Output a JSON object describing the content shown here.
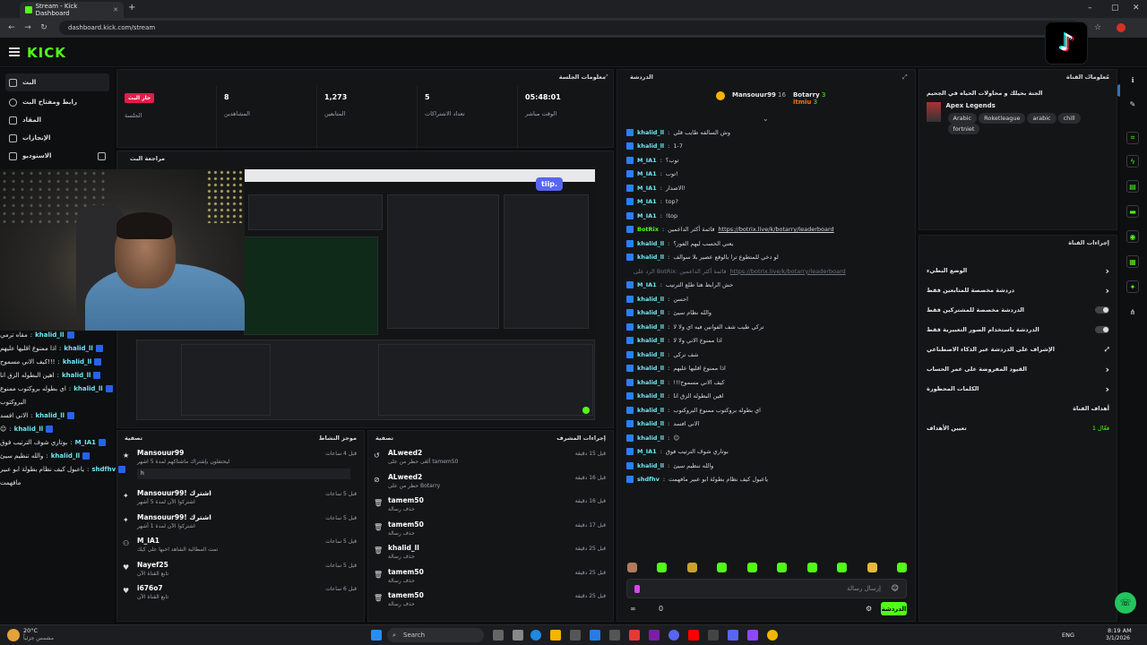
{
  "browser": {
    "tab_title": "Stream - Kick Dashboard",
    "new_tab": "+",
    "url": "dashboard.kick.com/stream",
    "win_min": "–",
    "win_max": "▢",
    "win_close": "✕"
  },
  "brand": {
    "logo": "KICK",
    "accent": "#53fc18"
  },
  "sidebar": {
    "items": [
      {
        "label": "البث"
      },
      {
        "label": "رابط ومفتاح البث"
      },
      {
        "label": "المقاد"
      },
      {
        "label": "الإنجازات"
      },
      {
        "label": "الاستوديو"
      }
    ]
  },
  "session": {
    "title": "معلومات الجلسة",
    "live_badge": "جار البث",
    "live_label": "الجلسة",
    "stats": [
      {
        "value": "8",
        "label": "المشاهدين"
      },
      {
        "value": "1,273",
        "label": "المتابعين"
      },
      {
        "value": "5",
        "label": "تعداد الاشتراكات"
      },
      {
        "value": "05:48:01",
        "label": "الوقت مباشر"
      }
    ]
  },
  "preview": {
    "title": "مراجعة البث",
    "tiip": "tiip."
  },
  "overlay_chat": [
    {
      "user": "khalid_ll",
      "msg": "مقاه ترمي"
    },
    {
      "user": "khalid_ll",
      "msg": "اذا ممنوع اقليها عليهم"
    },
    {
      "user": "khalid_ll",
      "msg": "!!!كيف الاني مسموح"
    },
    {
      "user": "khalid_ll",
      "msg": "اهين البطوله الزق انا"
    },
    {
      "user": "khalid_ll",
      "msg": "اي بطوله بروكتوب ممنوع"
    },
    {
      "user": "",
      "msg": "البروكتوب"
    },
    {
      "user": "khalid_ll",
      "msg": "الاني افسد"
    },
    {
      "user": "khalid_ll",
      "msg": "☺"
    },
    {
      "user": "M_IA1",
      "msg": "بوتاري شوف الترتيب فوق"
    },
    {
      "user": "khalid_ll",
      "msg": "والله تنظيم سيئ"
    },
    {
      "user": "shdfhv",
      "msg": "ياعبول كيف نظام بطولة ابو عبير"
    },
    {
      "user": "",
      "msg": "مافهمت"
    }
  ],
  "mods": {
    "title": "موجز النشاط",
    "filter": "تصفية",
    "rows": [
      {
        "icon": "★",
        "name": "Mansouur99",
        "sub": "ليحتفلون بإشتراك ماشتاكهم لمدة 5 اشهر",
        "time": "قبل 4 ساعات",
        "note": "h"
      },
      {
        "icon": "✦",
        "name": "Mansouur99! اشترك",
        "sub": "اشتركوا الآن لمدة 5 أشهر",
        "time": "قبل 5 ساعات"
      },
      {
        "icon": "✦",
        "name": "Mansouur99! اشترك",
        "sub": "اشتركوا الآن لمدة 1 أشهر",
        "time": "قبل 5 ساعات"
      },
      {
        "icon": "⚇",
        "name": "M_IA1",
        "sub": "تمت المطالبة الشاهد احبها على كيك",
        "time": "قبل 5 ساعات"
      },
      {
        "icon": "♥",
        "name": "Nayef25",
        "sub": "تابع القناة الآن",
        "time": "قبل 5 ساعات"
      },
      {
        "icon": "♥",
        "name": "i676o7",
        "sub": "تابع القناة الآن",
        "time": "قبل 6 ساعات"
      }
    ]
  },
  "actions": {
    "title": "إجراءات المشرف",
    "filter": "تصفية",
    "rows": [
      {
        "icon": "↺",
        "name": "ALweed2",
        "sub": "ألغى حظر من على tamem50",
        "time": "قبل 15 دقيقة"
      },
      {
        "icon": "⊘",
        "name": "ALweed2",
        "sub": "حظر من على Botarry",
        "time": "قبل 16 دقيقة"
      },
      {
        "icon": "🗑",
        "name": "tamem50",
        "sub": "حذف رسالة",
        "time": "قبل 16 دقيقة"
      },
      {
        "icon": "🗑",
        "name": "tamem50",
        "sub": "حذف رسالة",
        "time": "قبل 17 دقيقة"
      },
      {
        "icon": "🗑",
        "name": "khalid_ll",
        "sub": "حذف رسالة",
        "time": "قبل 25 دقيقة"
      },
      {
        "icon": "🗑",
        "name": "tamem50",
        "sub": "حذف رسالة",
        "time": "قبل 25 دقيقة"
      },
      {
        "icon": "🗑",
        "name": "tamem50",
        "sub": "حذف رسالة",
        "time": "قبل 25 دقيقة"
      }
    ]
  },
  "chat": {
    "title": "الدردشة",
    "leaders": [
      {
        "name": "Mansouur99",
        "count": "16"
      },
      {
        "name": "Botarry",
        "count": "3"
      },
      {
        "name": "itmiu",
        "count": "3"
      }
    ],
    "messages": [
      {
        "user": "khalid_ll",
        "msg": "وش السالفه طايب قلي"
      },
      {
        "user": "khalid_ll",
        "msg": "1-7"
      },
      {
        "user": "M_IA1",
        "msg": "توب؟"
      },
      {
        "user": "M_IA1",
        "msg": "توب!"
      },
      {
        "user": "M_IA1",
        "msg": "الاصدار!"
      },
      {
        "user": "M_IA1",
        "msg": "top?"
      },
      {
        "user": "M_IA1",
        "msg": "!top"
      },
      {
        "user": "BotRix",
        "msg": "قائمة أكثر الداعمين",
        "link": "https://botrix.live/k/botarry/leaderboard"
      },
      {
        "user": "khalid_ll",
        "msg": "يعني الحسب ليهم الفوز؟"
      },
      {
        "user": "khalid_ll",
        "msg": "لو دخي للمتطوع ترا بالوقع عصير بلا سوالف"
      },
      {
        "user": "",
        "msg": "الرد على BotRix: قائمة أكثر الداعمين",
        "link": "https://botrix.live/k/botarry/leaderboard"
      },
      {
        "user": "M_IA1",
        "msg": "حش الرابط هنا طلع الترتيب"
      },
      {
        "user": "khalid_ll",
        "msg": "احسن"
      },
      {
        "user": "khalid_ll",
        "msg": "والله نظام سيئ"
      },
      {
        "user": "khalid_ll",
        "msg": "تركي طيب شف الفوانين فيه اي ولا لا"
      },
      {
        "user": "khalid_ll",
        "msg": "اذا ممنوع الاني ولا لا"
      },
      {
        "user": "khalid_ll",
        "msg": "شف تركي"
      },
      {
        "user": "khalid_ll",
        "msg": "اذا ممنوع اقليها عليهم"
      },
      {
        "user": "khalid_ll",
        "msg": "!!!كيف الاني مسموح"
      },
      {
        "user": "khalid_ll",
        "msg": "اهين البطوله الزق انا"
      },
      {
        "user": "khalid_ll",
        "msg": "اي بطوله بروكتوب ممنوع البروكتوب"
      },
      {
        "user": "khalid_ll",
        "msg": "الاني افسد"
      },
      {
        "user": "khalid_ll",
        "msg": "☺"
      },
      {
        "user": "M_IA1",
        "msg": "بوتاري شوف الترتيب فوق"
      },
      {
        "user": "khalid_ll",
        "msg": "والله تنظيم سيئ"
      },
      {
        "user": "shdfhv",
        "msg": "ياعبول كيف نظام بطولة ابو عبير مافهمت"
      }
    ],
    "input_placeholder": "إرسال رسالة",
    "send_label": "الدردشة",
    "bottom_count": "0"
  },
  "info": {
    "title": "معلومات القناة",
    "stream_title": "الجنة بحيلك و محاولات الحياه في الجحيم",
    "category": "Apex Legends",
    "tags": [
      "Arabic",
      "Roketleague",
      "arabic",
      "chill",
      "fortniet"
    ]
  },
  "commands": {
    "title": "إجراءات القناة",
    "rows": [
      {
        "label": "الوضع البطيء",
        "kind": "arrow"
      },
      {
        "label": "دردشة مخصصة للمتابعين فقط",
        "kind": "arrow"
      },
      {
        "label": "الدردشة مخصصة للمشتركين فقط",
        "kind": "toggle"
      },
      {
        "label": "الدردشة باستخدام الصور التعبيرية فقط",
        "kind": "toggle"
      },
      {
        "label": "الإشراف على الدردشة عبر الذكاء الاصطناعي",
        "kind": "ext"
      },
      {
        "label": "القيود المفروضة على عمر الحساب",
        "kind": "arrow"
      },
      {
        "label": "الكلمات المحظورة",
        "kind": "arrow"
      }
    ],
    "goals_header": "أهداف القناة",
    "goals_label": "تعيين الأهداف",
    "goals_status": "فعّال 1"
  },
  "taskbar": {
    "weather_temp": "20°C",
    "weather_desc": "مشمس جزئياً",
    "search": "Search",
    "lang": "ENG",
    "time": "8:19 AM",
    "date": "3/1/2026"
  }
}
